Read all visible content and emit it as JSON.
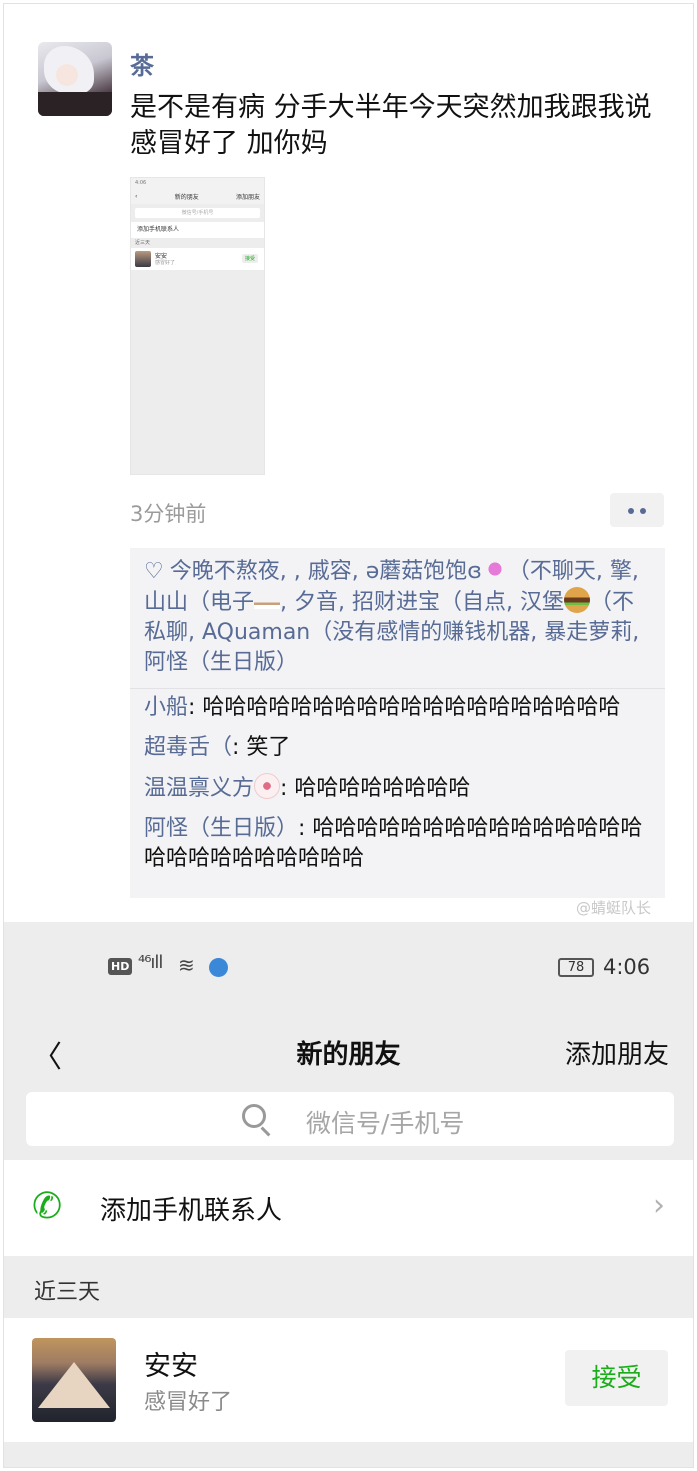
{
  "moment": {
    "poster_name": "茶",
    "text": "是不是有病 分手大半年今天突然加我跟我说感冒好了 加你妈",
    "thumbnail": {
      "status": "4:06",
      "title": "新的朋友",
      "add": "添加朋友",
      "search": "微信号/手机号",
      "add_contact": "添加手机联系人",
      "section": "近三天",
      "friend_name": "安安",
      "friend_msg": "感冒好了",
      "accept": "接受"
    },
    "time": "3分钟前",
    "likes": {
      "names_part1": "今晚不熬夜, , 戚容, ə蘑菇饱饱ɞ",
      "names_part2": "（不聊天, 擎, 山山（电子",
      "names_part3": ", 夕音, 招财进宝（自点, 汉堡",
      "names_part4": "（不私聊, AQuaman（没有感情的赚钱机器, 暴走萝莉, 阿怪（生日版）"
    },
    "comments": [
      {
        "name": "小船",
        "text": ": 哈哈哈哈哈哈哈哈哈哈哈哈哈哈哈哈哈哈哈"
      },
      {
        "name": "超毒舌（",
        "text": ": 笑了"
      },
      {
        "name": "温温禀义方",
        "text": ": 哈哈哈哈哈哈哈哈"
      },
      {
        "name": "阿怪（生日版）",
        "text": ": 哈哈哈哈哈哈哈哈哈哈哈哈哈哈哈哈哈哈哈哈哈哈哈哈哈"
      }
    ],
    "watermark": "@蜻蜓队长"
  },
  "phone": {
    "status": {
      "hd": "HD",
      "signal": "⁴⁶ıll",
      "battery": "78",
      "time": "4:06"
    },
    "nav": {
      "back": "〈",
      "title": "新的朋友",
      "add_friend": "添加朋友"
    },
    "search": {
      "placeholder": "微信号/手机号"
    },
    "add_contact": {
      "label": "添加手机联系人",
      "chevron": "›"
    },
    "section": "近三天",
    "friend": {
      "name": "安安",
      "message": "感冒好了",
      "accept": "接受"
    }
  }
}
